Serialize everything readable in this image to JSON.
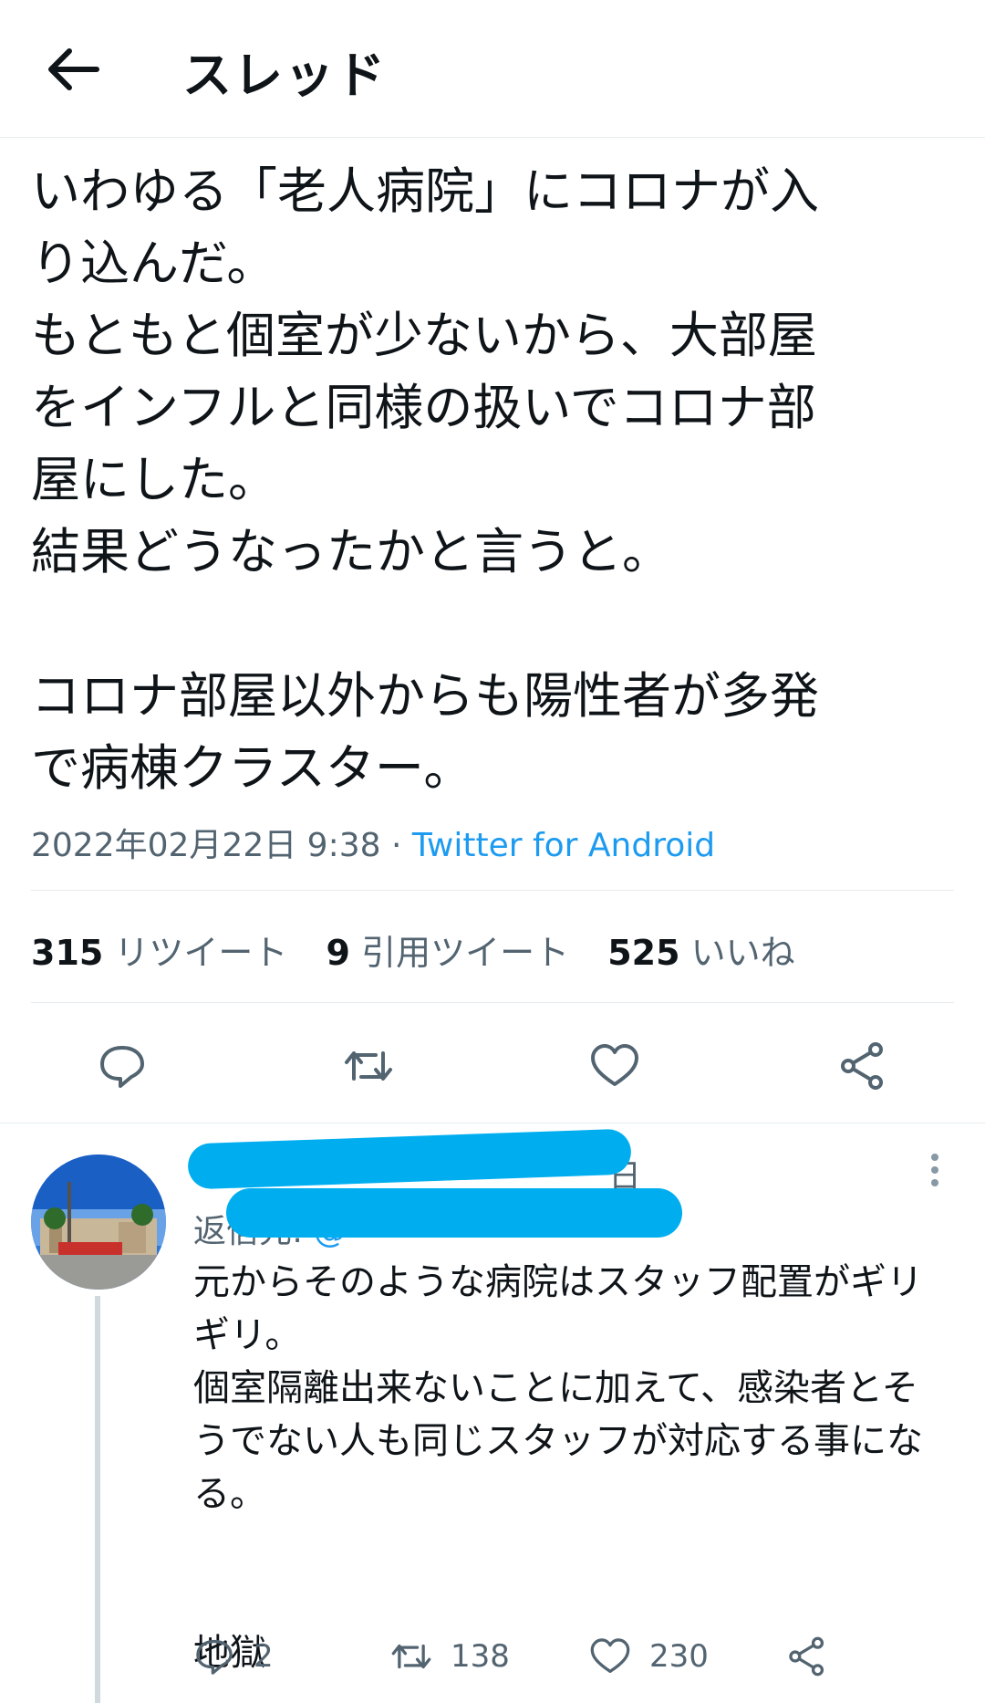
{
  "header": {
    "title": "スレッド"
  },
  "tweet": {
    "text": "いわゆる「老人病院」にコロナが入\nり込んだ。\nもともと個室が少ないから、大部屋\nをインフルと同様の扱いでコロナ部\n屋にした。\n結果どうなったかと言うと。\n\nコロナ部屋以外からも陽性者が多発\nで病棟クラスター。",
    "timestamp": "2022年02月22日 9:38",
    "separator": " · ",
    "source": "Twitter for Android"
  },
  "stats": {
    "retweets_count": "315",
    "retweets_label": "リツイート",
    "quotes_count": "9",
    "quotes_label": "引用ツイート",
    "likes_count": "525",
    "likes_label": "いいね"
  },
  "icons": [
    "back-arrow-icon",
    "reply-icon",
    "retweet-icon",
    "like-icon",
    "share-icon",
    "more-icon"
  ],
  "reply": {
    "name_partial": "· · ·",
    "time_partial": "日",
    "reply_to_label": "返信先:",
    "reply_to_handle": "@",
    "text": "元からそのような病院はスタッフ配置がギリ\nギリ。\n個室隔離出来ないことに加えて、感染者とそ\nうでない人も同じスタッフが対応する事にな\nる。\n\n\n地獄",
    "reply_count": "2",
    "retweet_count": "138",
    "like_count": "230"
  },
  "colors": {
    "accent": "#1d9bf0",
    "muted": "#536471",
    "redaction": "#00aef0"
  }
}
